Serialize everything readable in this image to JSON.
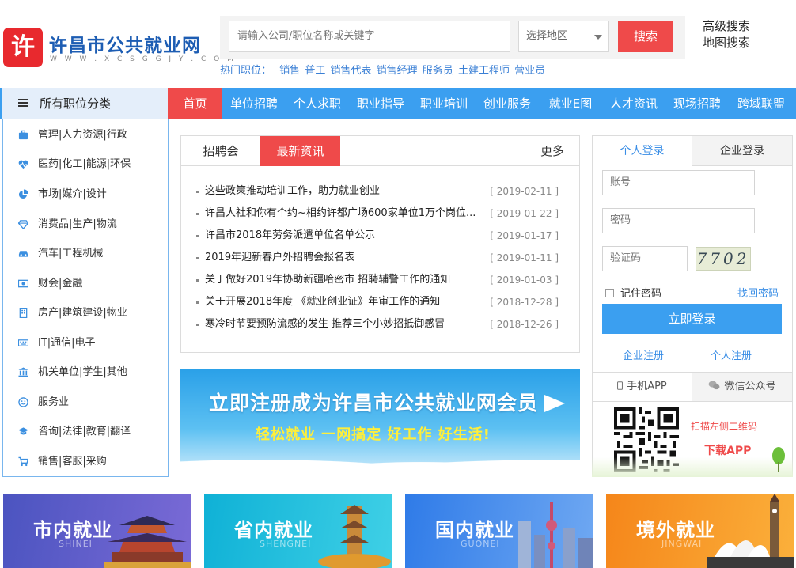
{
  "header": {
    "logo_char": "许",
    "site_name": "许昌市公共就业网",
    "site_domain": "W W W . X C S G G J Y . C O M"
  },
  "search": {
    "placeholder": "请输入公司/职位名称或关键字",
    "region_placeholder": "选择地区",
    "button": "搜索",
    "advanced": "高级搜索",
    "map": "地图搜索",
    "hot_label": "热门职位：",
    "hot_keywords": [
      "销售",
      "普工",
      "销售代表",
      "销售经理",
      "服务员",
      "土建工程师",
      "营业员"
    ]
  },
  "nav": {
    "categories_label": "所有职位分类",
    "items": [
      "首页",
      "单位招聘",
      "个人求职",
      "职业指导",
      "职业培训",
      "创业服务",
      "就业E图",
      "人才资讯",
      "现场招聘",
      "跨域联盟"
    ]
  },
  "categories": [
    {
      "label": "管理|人力资源|行政",
      "icon": "briefcase-icon"
    },
    {
      "label": "医药|化工|能源|环保",
      "icon": "heartbeat-icon"
    },
    {
      "label": "市场|媒介|设计",
      "icon": "pie-chart-icon"
    },
    {
      "label": "消费品|生产|物流",
      "icon": "diamond-icon"
    },
    {
      "label": "汽车|工程机械",
      "icon": "car-icon"
    },
    {
      "label": "财会|金融",
      "icon": "money-icon"
    },
    {
      "label": "房产|建筑建设|物业",
      "icon": "building-icon"
    },
    {
      "label": "IT|通信|电子",
      "icon": "keyboard-icon"
    },
    {
      "label": "机关单位|学生|其他",
      "icon": "bank-icon"
    },
    {
      "label": "服务业",
      "icon": "smile-icon"
    },
    {
      "label": "咨询|法律|教育|翻译",
      "icon": "graduation-cap-icon"
    },
    {
      "label": "销售|客服|采购",
      "icon": "cart-icon"
    }
  ],
  "news": {
    "tab_fair": "招聘会",
    "tab_latest": "最新资讯",
    "more": "更多",
    "items": [
      {
        "title": "这些政策推动培训工作，助力就业创业",
        "date": "[ 2019-02-11 ]"
      },
      {
        "title": "许昌人社和你有个约~相约许都广场600家单位1万个岗位...",
        "date": "[ 2019-01-22 ]"
      },
      {
        "title": "许昌市2018年劳务派遣单位名单公示",
        "date": "[ 2019-01-17 ]"
      },
      {
        "title": "2019年迎新春户外招聘会报名表",
        "date": "[ 2019-01-11 ]"
      },
      {
        "title": "关于做好2019年协助新疆哈密市 招聘辅警工作的通知",
        "date": "[ 2019-01-03 ]"
      },
      {
        "title": "关于开展2018年度 《就业创业证》年审工作的通知",
        "date": "[ 2018-12-28 ]"
      },
      {
        "title": "寒冷时节要预防流感的发生 推荐三个小妙招抵御感冒",
        "date": "[ 2018-12-26 ]"
      }
    ]
  },
  "banner": {
    "headline": "立即注册成为许昌市公共就业网会员",
    "slogan": "轻松就业  一网搞定    好工作  好生活!"
  },
  "login": {
    "tab_personal": "个人登录",
    "tab_enterprise": "企业登录",
    "account_placeholder": "账号",
    "password_placeholder": "密码",
    "captcha_placeholder": "验证码",
    "captcha_code": "7702",
    "remember": "记住密码",
    "forgot": "找回密码",
    "submit": "立即登录",
    "reg_enterprise": "企业注册",
    "reg_personal": "个人注册",
    "app_tab": "手机APP",
    "wechat_tab": "微信公众号",
    "scan_hint": "扫描左侧二维码",
    "download": "下载APP"
  },
  "tiles": [
    {
      "title": "市内就业",
      "subtitle": "SHINEI",
      "color": "#5b5fc7"
    },
    {
      "title": "省内就业",
      "subtitle": "SHENGNEI",
      "color": "#1fb7d8"
    },
    {
      "title": "国内就业",
      "subtitle": "GUONEI",
      "color": "#3f86ea"
    },
    {
      "title": "境外就业",
      "subtitle": "JINGWAI",
      "color": "#f58a1f"
    }
  ],
  "colors": {
    "brand_red": "#ef4a4a",
    "nav_blue": "#3b9ff0",
    "link_blue": "#3a8ee6"
  }
}
